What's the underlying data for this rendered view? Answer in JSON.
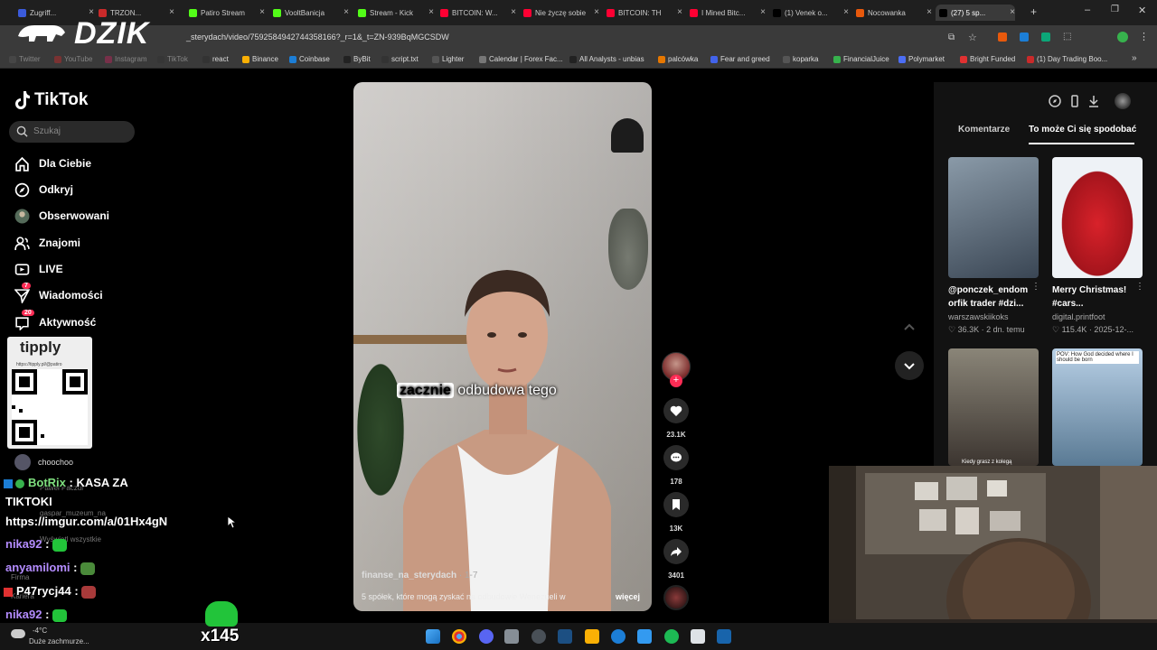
{
  "browser": {
    "tabs": [
      {
        "label": "Zugriff...",
        "color": "#3b5bdb"
      },
      {
        "label": "TRZON...",
        "color": "#c92a2a"
      },
      {
        "label": "Patiro Stream",
        "color": "#53fc18"
      },
      {
        "label": "VooltBanicja",
        "color": "#53fc18"
      },
      {
        "label": "Stream - Kick",
        "color": "#53fc18"
      },
      {
        "label": "BITCOIN: W...",
        "color": "#ff0033"
      },
      {
        "label": "Nie życzę sobie",
        "color": "#ff0033"
      },
      {
        "label": "BITCOIN: TH",
        "color": "#ff0033"
      },
      {
        "label": "I Mined Bitc...",
        "color": "#ff0033"
      },
      {
        "label": "(1) Venek o...",
        "color": "#000000"
      },
      {
        "label": "Nocowanka",
        "color": "#e8590c"
      },
      {
        "label": "(27) 5 sp...",
        "color": "#000000"
      }
    ],
    "url": "_sterydach/video/7592584942744358166?_r=1&_t=ZN-939BqMGCSDW",
    "bookmarks": [
      "Twitter",
      "YouTube",
      "Instagram",
      "TikTok",
      "react",
      "Binance",
      "Coinbase",
      "ByBit",
      "script.txt",
      "Lighter",
      "Calendar | Forex Fac...",
      "All Analysts - unbias",
      "palcówka",
      "Fear and greed",
      "koparka",
      "FinancialJuice",
      "Polymarket",
      "Bright Funded",
      "(1) Day Trading Boo..."
    ]
  },
  "overlay": {
    "logo": "DZIK",
    "qr_title": "tipply",
    "qr_url": "https://tipply.pl/@patiro",
    "chat": [
      {
        "user": "BotRix",
        "sep": " : ",
        "msg": "KASA ZA",
        "color": "#7fe07f"
      },
      {
        "msg": "TIKTOKI"
      },
      {
        "msg": "https://imgur.com/a/01Hx4gN"
      },
      {
        "user": "nika92",
        "sep": " : ",
        "color": "#b48cff"
      },
      {
        "user": "anyamilomi",
        "sep": " : ",
        "color": "#b48cff"
      },
      {
        "user": "P47rycj44",
        "sep": " : ",
        "color": "#ffffff"
      },
      {
        "user": "nika92",
        "sep": " : ",
        "color": "#b48cff"
      }
    ],
    "multiplier": "x145"
  },
  "tiktok": {
    "brand": "TikTok",
    "search_placeholder": "Szukaj",
    "nav": [
      {
        "label": "Dla Ciebie",
        "icon": "home-icon"
      },
      {
        "label": "Odkryj",
        "icon": "compass-icon"
      },
      {
        "label": "Obserwowani",
        "icon": "avatar-icon"
      },
      {
        "label": "Znajomi",
        "icon": "friends-icon"
      },
      {
        "label": "LIVE",
        "icon": "live-icon"
      },
      {
        "label": "Wiadomości",
        "icon": "inbox-icon",
        "badge": "7"
      },
      {
        "label": "Aktywność",
        "icon": "activity-icon",
        "badge": "20"
      }
    ],
    "following_partial": "choochoo",
    "ghost_items": [
      "Paweł Paczul",
      "gaspar_muzeum_na",
      "Wyświetl wszystkie",
      "Firma",
      "Kariera"
    ],
    "video": {
      "caption_highlight": "zacznie",
      "caption_rest": " odbudowa tego",
      "author": "finanse_na_sterydach",
      "date": " · 1-7",
      "description": "5 spółek, które mogą zyskać na odbudowie Wenezueli w",
      "more": "więcej"
    },
    "actions": {
      "likes": "23.1K",
      "comments": "178",
      "saves": "13K",
      "shares": "3401"
    },
    "right_tabs": {
      "comments": "Komentarze",
      "suggested": "To może Ci się spodobać"
    },
    "recommendations": [
      {
        "title": "@ponczek_endom orfik trader #dzi...",
        "author": "warszawskiikoks",
        "stats": "36.3K · 2 dn. temu",
        "thumb": "#4a5a6a"
      },
      {
        "title": "Merry Christmas! #cars...",
        "author": "digital.printfoot",
        "stats": "115.4K · 2025-12-...",
        "thumb": "#c0202a"
      },
      {
        "title": "Kiedy grasz z kolegą",
        "author": "",
        "stats": "",
        "thumb": "#6a5a48"
      },
      {
        "title": "POV: How God decided where I should be born",
        "author": "",
        "stats": "",
        "thumb": "#6a8aa8"
      }
    ]
  },
  "taskbar": {
    "temp": "-4°C",
    "weather": "Duże zachmurze..."
  }
}
